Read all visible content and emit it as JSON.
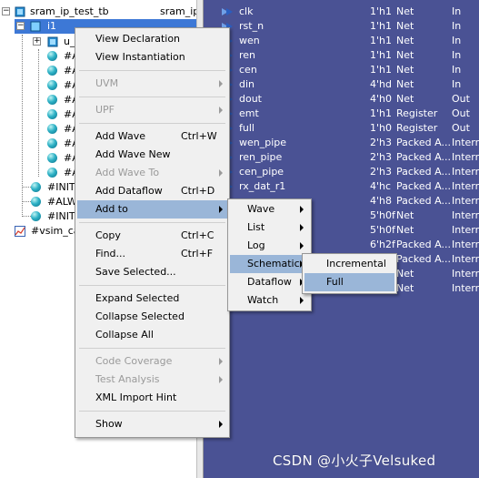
{
  "colors": {
    "objects_bg": "#4a5294",
    "menu_bg": "#f0f0f0",
    "menu_highlight": "#9ab6d8",
    "tree_selection": "#3d78d6"
  },
  "structure": {
    "header": {
      "name": "sram_ip_test_tb",
      "type": "sram_ip"
    },
    "selected": {
      "name": "i1"
    },
    "rows": [
      {
        "name": "u_",
        "icon": "instance-icon"
      },
      {
        "name": "#A",
        "icon": "process-icon"
      },
      {
        "name": "#A",
        "icon": "process-icon"
      },
      {
        "name": "#A",
        "icon": "process-icon"
      },
      {
        "name": "#A",
        "icon": "process-icon"
      },
      {
        "name": "#A",
        "icon": "process-icon"
      },
      {
        "name": "#A",
        "icon": "process-icon"
      },
      {
        "name": "#A",
        "icon": "process-icon"
      },
      {
        "name": "#A",
        "icon": "process-icon"
      },
      {
        "name": "#A",
        "icon": "process-icon"
      },
      {
        "name": "#INIT",
        "icon": "process-icon"
      },
      {
        "name": "#ALW",
        "icon": "process-icon"
      },
      {
        "name": "#INIT",
        "icon": "process-icon"
      },
      {
        "name": "#vsim_ca",
        "icon": "capacity-icon"
      }
    ]
  },
  "objects": [
    {
      "name": "clk",
      "value": "1'h1",
      "kind": "Net",
      "dir": "In"
    },
    {
      "name": "rst_n",
      "value": "1'h1",
      "kind": "Net",
      "dir": "In"
    },
    {
      "name": "wen",
      "value": "1'h1",
      "kind": "Net",
      "dir": "In"
    },
    {
      "name": "ren",
      "value": "1'h1",
      "kind": "Net",
      "dir": "In"
    },
    {
      "name": "cen",
      "value": "1'h1",
      "kind": "Net",
      "dir": "In"
    },
    {
      "name": "din",
      "value": "4'hd",
      "kind": "Net",
      "dir": "In"
    },
    {
      "name": "dout",
      "value": "4'h0",
      "kind": "Net",
      "dir": "Out"
    },
    {
      "name": "emt",
      "value": "1'h1",
      "kind": "Register",
      "dir": "Out"
    },
    {
      "name": "full",
      "value": "1'h0",
      "kind": "Register",
      "dir": "Out"
    },
    {
      "name": "wen_pipe",
      "value": "2'h3",
      "kind": "Packed A...",
      "dir": "Intern"
    },
    {
      "name": "ren_pipe",
      "value": "2'h3",
      "kind": "Packed A...",
      "dir": "Intern"
    },
    {
      "name": "cen_pipe",
      "value": "2'h3",
      "kind": "Packed A...",
      "dir": "Intern"
    },
    {
      "name": "rx_dat_r1",
      "value": "4'hc",
      "kind": "Packed A...",
      "dir": "Intern"
    },
    {
      "name": "",
      "value": "4'h8",
      "kind": "Packed A...",
      "dir": "Intern"
    },
    {
      "name": "",
      "value": "5'h0f",
      "kind": "Net",
      "dir": "Intern"
    },
    {
      "name": "",
      "value": "5'h0f",
      "kind": "Net",
      "dir": "Intern"
    },
    {
      "name": "",
      "value": "6'h2f",
      "kind": "Packed A...",
      "dir": "Intern"
    },
    {
      "name": "",
      "value": "",
      "kind": "Packed A...",
      "dir": "Intern"
    },
    {
      "name": "",
      "value": "",
      "kind": "Net",
      "dir": "Intern"
    },
    {
      "name": "",
      "value": "",
      "kind": "Net",
      "dir": "Intern"
    }
  ],
  "context_menu": {
    "items": [
      {
        "label": "View Declaration"
      },
      {
        "label": "View Instantiation"
      },
      {
        "label": "UVM",
        "submenu": true,
        "disabled": true
      },
      {
        "label": "UPF",
        "submenu": true,
        "disabled": true
      },
      {
        "label": "Add Wave",
        "shortcut": "Ctrl+W"
      },
      {
        "label": "Add Wave New"
      },
      {
        "label": "Add Wave To",
        "submenu": true,
        "disabled": true
      },
      {
        "label": "Add Dataflow",
        "shortcut": "Ctrl+D"
      },
      {
        "label": "Add to",
        "submenu": true,
        "highlighted": true
      },
      {
        "label": "Copy",
        "shortcut": "Ctrl+C"
      },
      {
        "label": "Find...",
        "shortcut": "Ctrl+F"
      },
      {
        "label": "Save Selected..."
      },
      {
        "label": "Expand Selected"
      },
      {
        "label": "Collapse Selected"
      },
      {
        "label": "Collapse All"
      },
      {
        "label": "Code Coverage",
        "submenu": true,
        "disabled": true
      },
      {
        "label": "Test Analysis",
        "submenu": true,
        "disabled": true
      },
      {
        "label": "XML Import Hint"
      },
      {
        "label": "Show",
        "submenu": true
      }
    ]
  },
  "add_to_menu": {
    "items": [
      {
        "label": "Wave",
        "submenu": true
      },
      {
        "label": "List",
        "submenu": true
      },
      {
        "label": "Log",
        "submenu": true
      },
      {
        "label": "Schematic",
        "submenu": true,
        "highlighted": true
      },
      {
        "label": "Dataflow",
        "submenu": true
      },
      {
        "label": "Watch",
        "submenu": true
      }
    ]
  },
  "schematic_menu": {
    "items": [
      {
        "label": "Incremental"
      },
      {
        "label": "Full",
        "highlighted": true
      }
    ]
  },
  "watermark": "CSDN @小火子Velsuked"
}
